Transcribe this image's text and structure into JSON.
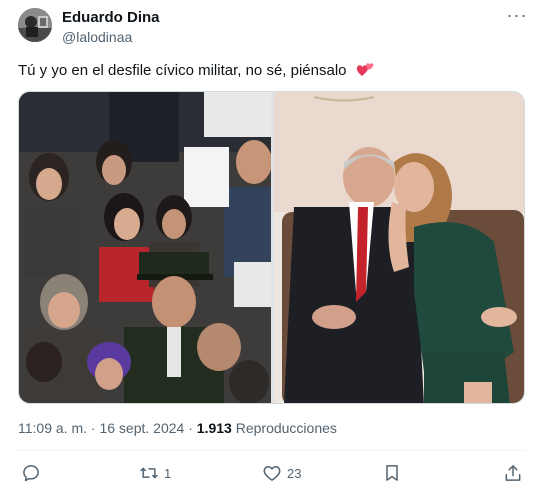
{
  "author": {
    "name": "Eduardo Dina",
    "handle": "@lalodinaa"
  },
  "tweet": {
    "text": "Tú y yo en el desfile cívico militar, no sé, piénsalo",
    "emoji": "two-hearts-icon"
  },
  "meta": {
    "time": "11:09 a. m.",
    "separator": "·",
    "date": "16 sept. 2024",
    "views_count": "1.913",
    "views_label": "Reproducciones"
  },
  "actions": {
    "replies": "",
    "retweets": "1",
    "likes": "23"
  },
  "icons": {
    "more": "more-dots-icon",
    "reply": "reply-icon",
    "retweet": "retweet-icon",
    "like": "heart-icon",
    "bookmark": "bookmark-icon",
    "share": "share-icon"
  },
  "colors": {
    "text_primary": "#0f1419",
    "text_secondary": "#536471",
    "border": "#cfd9de",
    "heart_emoji": "#e8385a"
  }
}
